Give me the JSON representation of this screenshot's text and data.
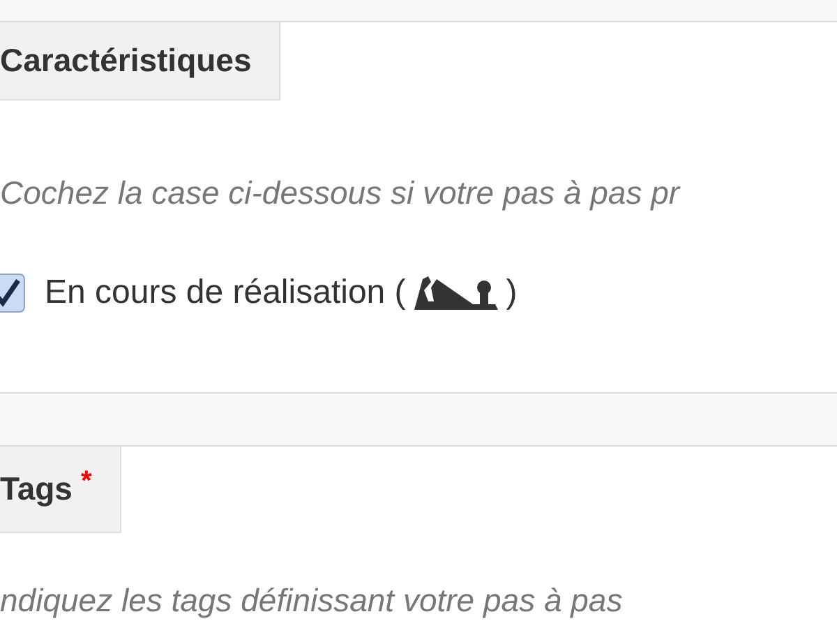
{
  "sections": [
    {
      "heading": "Caractéristiques",
      "description": "Cochez la case ci-dessous si votre pas à pas pr",
      "checkbox": {
        "label_before": "En cours de réalisation (",
        "label_after": ")",
        "checked": true
      }
    },
    {
      "heading": "Tags",
      "required_mark": "*",
      "description": "ndiquez les tags définissant votre pas à pas"
    }
  ]
}
